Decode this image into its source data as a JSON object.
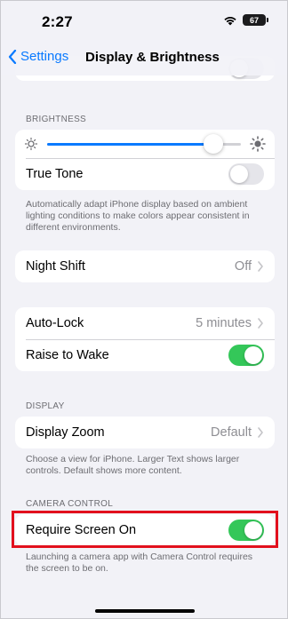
{
  "status_bar": {
    "time": "2:27",
    "battery": "67"
  },
  "nav": {
    "back_label": "Settings",
    "title": "Display & Brightness"
  },
  "brightness": {
    "section_label": "BRIGHTNESS",
    "level": 0.86,
    "true_tone_label": "True Tone",
    "true_tone_on": false,
    "footnote": "Automatically adapt iPhone display based on ambient lighting conditions to make colors appear consistent in different environments."
  },
  "night_shift": {
    "label": "Night Shift",
    "value": "Off"
  },
  "lock": {
    "auto_lock_label": "Auto-Lock",
    "auto_lock_value": "5 minutes",
    "raise_to_wake_label": "Raise to Wake",
    "raise_to_wake_on": true
  },
  "display": {
    "section_label": "DISPLAY",
    "zoom_label": "Display Zoom",
    "zoom_value": "Default",
    "footnote": "Choose a view for iPhone. Larger Text shows larger controls. Default shows more content."
  },
  "camera_control": {
    "section_label": "CAMERA CONTROL",
    "require_screen_on_label": "Require Screen On",
    "require_screen_on": true,
    "footnote": "Launching a camera app with Camera Control requires the screen to be on."
  },
  "colors": {
    "accent": "#0a7aff",
    "toggle_on": "#34c759",
    "highlight": "#e2101d"
  }
}
